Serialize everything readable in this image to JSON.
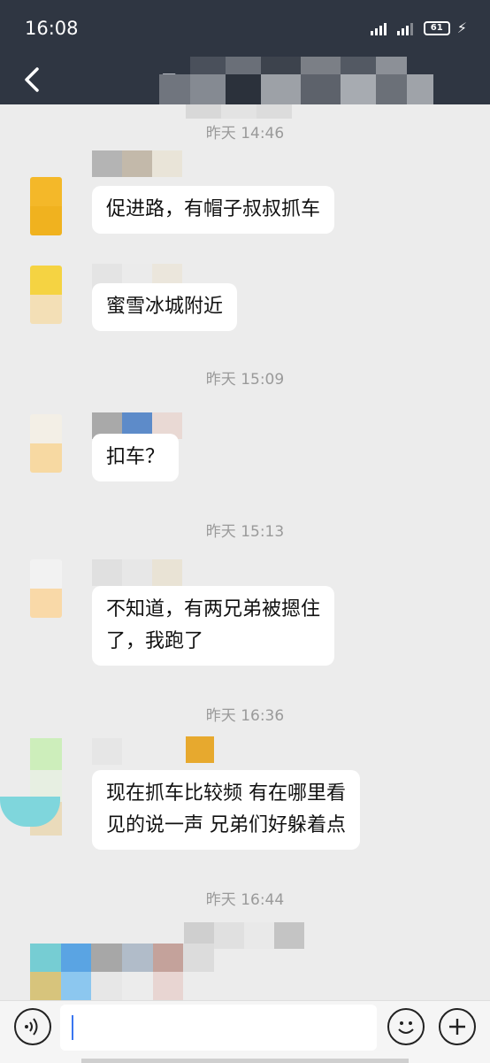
{
  "status_bar": {
    "time": "16:08",
    "battery": "61"
  },
  "header": {
    "title": "易"
  },
  "messages": [
    {
      "timestamp": "昨天 14:46",
      "lines": [
        "促进路，有帽子叔叔抓车"
      ]
    },
    {
      "lines": [
        "蜜雪冰城附近"
      ]
    },
    {
      "timestamp": "昨天 15:09",
      "lines": [
        "扣车？"
      ]
    },
    {
      "timestamp": "昨天 15:13",
      "lines": [
        "不知道，有两兄弟被摁住",
        "了，我跑了"
      ]
    },
    {
      "timestamp": "昨天 16:36",
      "lines": [
        "现在抓车比较频 有在哪里看",
        "见的说一声 兄弟们好躲着点"
      ]
    },
    {
      "timestamp": "昨天 16:44"
    }
  ],
  "input": {
    "value": ""
  },
  "colors": {
    "header_bg": "#2f3642",
    "chat_bg": "#ececec",
    "bubble_bg": "#ffffff",
    "caret": "#3a76f0"
  },
  "icons": {
    "back": "chevron-left-icon",
    "voice": "voice-icon",
    "emoji": "emoji-icon",
    "add": "plus-icon"
  }
}
